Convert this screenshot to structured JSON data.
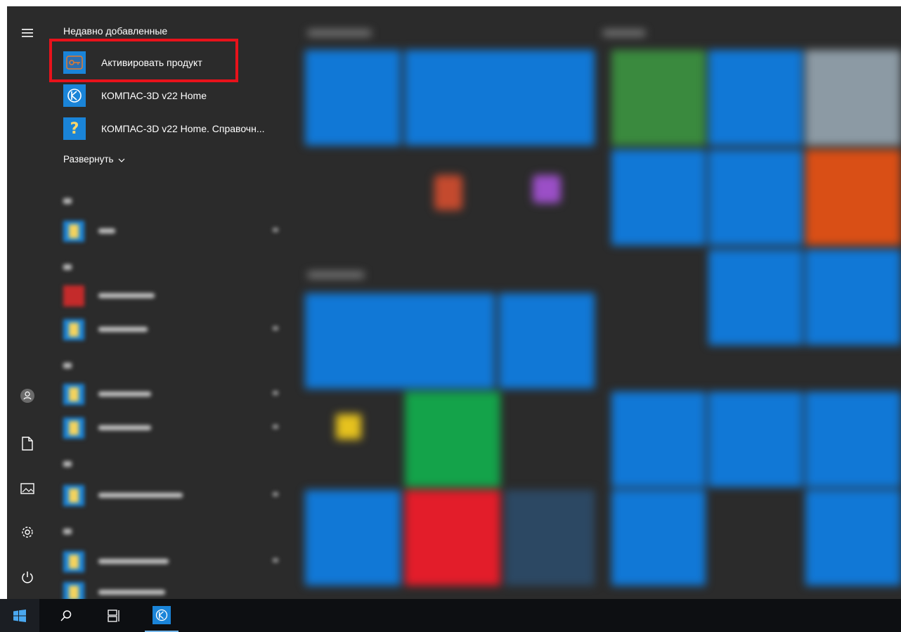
{
  "recent": {
    "heading": "Недавно добавленные",
    "items": [
      {
        "label": "Активировать продукт",
        "icon": "kompas-activation-icon"
      },
      {
        "label": "КОМПАС-3D v22 Home",
        "icon": "kompas-icon"
      },
      {
        "label": "КОМПАС-3D v22 Home. Справочн...",
        "icon": "help-question-icon"
      }
    ],
    "expand_label": "Развернуть"
  },
  "colors": {
    "background": "#2b2b2b",
    "tile_blue": "#1178d6",
    "highlight": "#e8121b",
    "taskbar": "#0d0f12"
  }
}
